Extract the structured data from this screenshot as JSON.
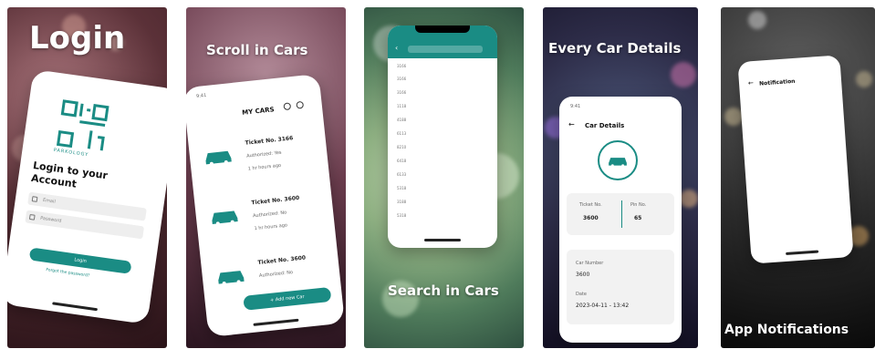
{
  "panels": {
    "p1": {
      "caption": "Login",
      "brand": "PARKOLOGY",
      "title_line1": "Login to your",
      "title_line2": "Account",
      "email_placeholder": "Email",
      "password_placeholder": "Password",
      "login_button": "Login",
      "forgot_link": "Forgot the password?"
    },
    "p2": {
      "caption": "Scroll in Cars",
      "status_time": "9:41",
      "header_title": "MY CARS",
      "cars": [
        {
          "ticket": "Ticket No. 3166",
          "sub": "Authorized: Yes",
          "time": "1 hr hours ago"
        },
        {
          "ticket": "Ticket No. 3600",
          "sub": "Authorized: No",
          "time": "1 hr hours ago"
        },
        {
          "ticket": "Ticket No. 3600",
          "sub": "Authorized: No",
          "time": ""
        }
      ],
      "add_button": "+ Add new Car"
    },
    "p3": {
      "caption": "Search in Cars",
      "rows": [
        "3166",
        "3166",
        "3166",
        "1118",
        "4188",
        "6113",
        "8210",
        "6418",
        "6133",
        "5318",
        "3188",
        "5318"
      ]
    },
    "p4": {
      "caption": "Every Car Details",
      "status_time": "9:41",
      "title": "Car Details",
      "ticket_label": "Ticket No.",
      "ticket_value": "3600",
      "pin_label": "Pin No.",
      "pin_value": "65",
      "plate_label": "Car Number",
      "plate_value": "3600",
      "date_label": "Date",
      "date_value": "2023-04-11 - 13:42"
    },
    "p5": {
      "caption": "App Notifications",
      "title": "Notification"
    }
  },
  "colors": {
    "accent": "#1a8c84"
  }
}
